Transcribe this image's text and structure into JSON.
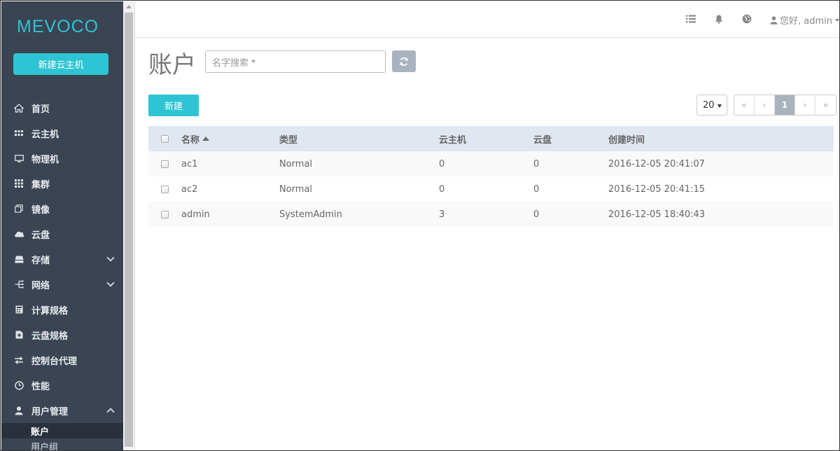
{
  "brand": {
    "logo": "MEVOCO",
    "accent": "#2ec4d3",
    "sidebar_bg": "#3a4452"
  },
  "sidebar": {
    "new_vm_label": "新建云主机",
    "items": [
      {
        "label": "首页",
        "icon": "home-icon"
      },
      {
        "label": "云主机",
        "icon": "vm-grid-icon"
      },
      {
        "label": "物理机",
        "icon": "monitor-icon"
      },
      {
        "label": "集群",
        "icon": "cluster-grid-icon"
      },
      {
        "label": "镜像",
        "icon": "image-copy-icon"
      },
      {
        "label": "云盘",
        "icon": "cloud-icon"
      },
      {
        "label": "存储",
        "icon": "storage-icon",
        "expandable": true
      },
      {
        "label": "网络",
        "icon": "network-icon",
        "expandable": true
      },
      {
        "label": "计算规格",
        "icon": "compute-spec-icon"
      },
      {
        "label": "云盘规格",
        "icon": "disk-spec-icon"
      },
      {
        "label": "控制台代理",
        "icon": "exchange-icon"
      },
      {
        "label": "性能",
        "icon": "dashboard-icon"
      },
      {
        "label": "用户管理",
        "icon": "user-icon",
        "expanded": true
      }
    ],
    "sub_items": [
      {
        "label": "账户",
        "active": true
      },
      {
        "label": "用户组",
        "active": false
      }
    ]
  },
  "topbar": {
    "user_label": "您好, admin",
    "icons": [
      "list-icon",
      "bell-icon",
      "globe-icon",
      "user-icon"
    ]
  },
  "main": {
    "title": "账户",
    "search_placeholder": "名字搜索",
    "create_label": "新建",
    "page_size": "20",
    "pager": {
      "first": "«",
      "prev": "‹",
      "current": "1",
      "next": "›",
      "last": "»"
    }
  },
  "table": {
    "columns": [
      "名称",
      "类型",
      "云主机",
      "云盘",
      "创建时间"
    ],
    "rows": [
      {
        "name": "ac1",
        "type": "Normal",
        "vms": "0",
        "disks": "0",
        "created": "2016-12-05 20:41:07"
      },
      {
        "name": "ac2",
        "type": "Normal",
        "vms": "0",
        "disks": "0",
        "created": "2016-12-05 20:41:15"
      },
      {
        "name": "admin",
        "type": "SystemAdmin",
        "vms": "3",
        "disks": "0",
        "created": "2016-12-05 18:40:43"
      }
    ]
  }
}
